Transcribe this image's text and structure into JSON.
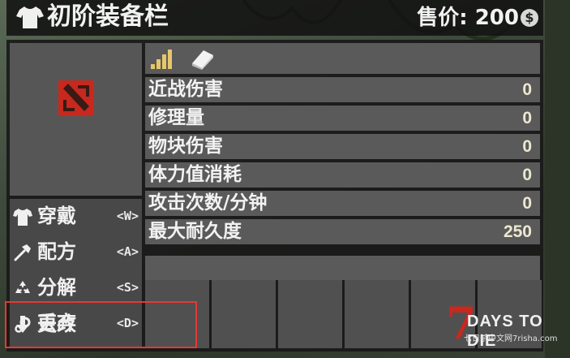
{
  "title": "初阶装备栏",
  "price": {
    "label": "售价: 200",
    "currency_icon": "coin-icon"
  },
  "item": {
    "icon": "item-icon"
  },
  "stats_header": {
    "quality_icon": "quality-bars-icon",
    "book_icon": "book-icon"
  },
  "stats": [
    {
      "label": "近战伤害",
      "value": "0"
    },
    {
      "label": "修理量",
      "value": "0"
    },
    {
      "label": "物块伤害",
      "value": "0"
    },
    {
      "label": "体力值消耗",
      "value": "0"
    },
    {
      "label": "攻击次数/分钟",
      "value": "0"
    },
    {
      "label": "最大耐久度",
      "value": "250"
    }
  ],
  "actions": [
    {
      "label": "穿戴",
      "key": "<W>",
      "icon": "shirt-icon"
    },
    {
      "label": "配方",
      "key": "<A>",
      "icon": "hammer-icon"
    },
    {
      "label": "分解",
      "key": "<S>",
      "icon": "recycle-icon"
    },
    {
      "label": "丢弃",
      "key": "<D>",
      "icon": "drop-arrow-icon"
    },
    {
      "label": "更改",
      "key": "",
      "icon": "gears-icon"
    }
  ],
  "watermark": {
    "logo": "7",
    "text": "DAYS TO DIE",
    "sub": "七日杀中文网7risha.com"
  },
  "colors": {
    "highlight": "#e53935",
    "item_icon": "#c8281e"
  }
}
